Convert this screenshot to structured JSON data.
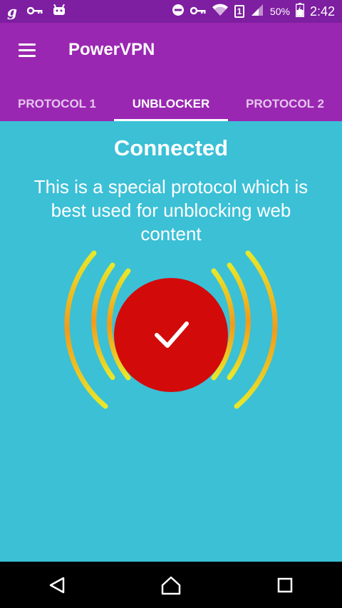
{
  "status_bar": {
    "carrier_letter": "g",
    "battery_percent": "50%",
    "sim_slot": "1",
    "time": "2:42"
  },
  "app_bar": {
    "title": "PowerVPN"
  },
  "tabs": [
    {
      "label": "PROTOCOL 1",
      "active": false
    },
    {
      "label": "UNBLOCKER",
      "active": true
    },
    {
      "label": "PROTOCOL 2",
      "active": false
    }
  ],
  "main": {
    "status_text": "Connected",
    "description": "This is a special protocol which is best used for unblocking web content"
  },
  "colors": {
    "status_bar_bg": "#7e1ea1",
    "app_bar_bg": "#9a27b1",
    "main_bg": "#3bc0d6",
    "button_red": "#d20a0a",
    "wave_inner": "#f2b21a",
    "wave_outer": "#e8e82a"
  },
  "icons": {
    "menu": "hamburger-menu-icon",
    "connect_state": "checkmark-icon",
    "nav_back": "back-triangle-icon",
    "nav_home": "home-icon",
    "nav_recents": "recents-square-icon"
  }
}
